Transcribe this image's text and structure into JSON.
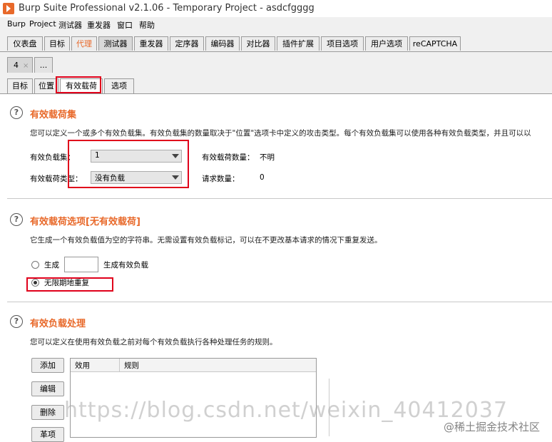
{
  "window": {
    "title": "Burp Suite Professional v2.1.06 - Temporary Project - asdcfgggg"
  },
  "menu": [
    "Burp",
    "Project",
    "测试器",
    "重发器",
    "窗口",
    "帮助"
  ],
  "main_tabs": [
    "仪表盘",
    "目标",
    "代理",
    "测试器",
    "重发器",
    "定序器",
    "编码器",
    "对比器",
    "插件扩展",
    "项目选项",
    "用户选项",
    "reCAPTCHA"
  ],
  "attack_tabs": {
    "current": "4",
    "close": "×",
    "more": "..."
  },
  "sub_tabs": [
    "目标",
    "位置",
    "有效载荷",
    "选项"
  ],
  "payload_sets": {
    "title": "有效载荷集",
    "description": "您可以定义一个或多个有效负载集。有效负载集的数量取决于\"位置\"选项卡中定义的攻击类型。每个有效负载集可以使用各种有效负载类型，并且可以以",
    "set_label": "有效负载集：",
    "set_value": "1",
    "type_label": "有效载荷类型：",
    "type_value": "没有负载",
    "count_label": "有效载荷数量：",
    "count_value": "不明",
    "requests_label": "请求数量：",
    "requests_value": "0"
  },
  "payload_options": {
    "title": "有效载荷选项[无有效载荷]",
    "description": "它生成一个有效负载值为空的字符串。无需设置有效负载标记，可以在不更改基本请求的情况下重复发送。",
    "generate_label": "生成",
    "generate_suffix": "生成有效负载",
    "generate_value": "",
    "infinite_label": "无限期地重复"
  },
  "payload_processing": {
    "title": "有效负载处理",
    "description": "您可以定义在使用有效负载之前对每个有效负载执行各种处理任务的规则。",
    "buttons": [
      "添加",
      "编辑",
      "删除",
      "革项"
    ],
    "columns": [
      "效用",
      "规则"
    ]
  },
  "watermark": {
    "url": "https://blog.csdn.net/weixin_40412037",
    "site": "@稀土掘金技术社区"
  },
  "colors": {
    "accent": "#e8692a",
    "annotation": "#e0001b"
  }
}
